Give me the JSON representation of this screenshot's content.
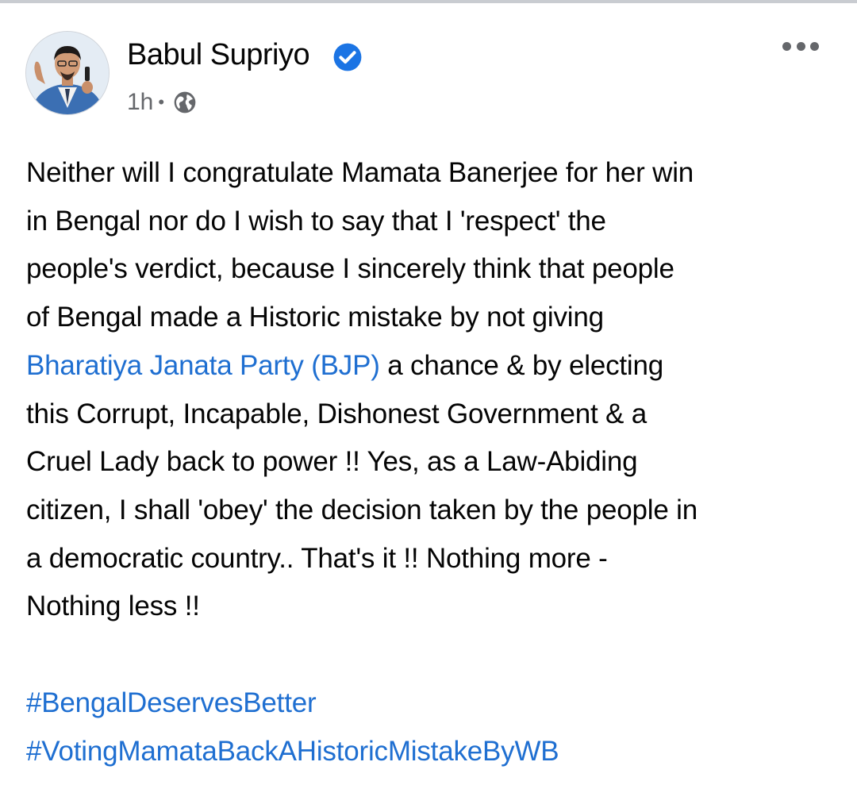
{
  "post": {
    "author": {
      "name": "Babul Supriyo",
      "verified_icon": "verified-badge-icon",
      "avatar_icon": "profile-photo"
    },
    "meta": {
      "time": "1h",
      "separator": "•",
      "audience_icon": "globe-icon"
    },
    "more_icon": "more-options-icon",
    "body": {
      "line1": "Neither will I congratulate Mamata Banerjee for her win",
      "line2": "in Bengal nor do I wish to say that I 'respect' the",
      "line3": "people's verdict, because I sincerely think that people",
      "line4": "of Bengal made a Historic mistake by not giving",
      "line5_mention": "Bharatiya Janata Party (BJP)",
      "line5_rest": " a chance & by electing",
      "line6": "this Corrupt, Incapable, Dishonest Government & a",
      "line7": "Cruel Lady back to power !! Yes, as a Law-Abiding",
      "line8": "citizen, I shall 'obey' the decision taken by the people in",
      "line9": "a democratic country.. That's it !! Nothing more -",
      "line10": "Nothing less !!"
    },
    "hashtags": [
      "#BengalDeservesBetter",
      "#VotingMamataBackAHistoricMistakeByWB"
    ]
  },
  "colors": {
    "link": "#1f6fd1",
    "verified": "#1b74e4",
    "secondary_text": "#65676b",
    "primary_text": "#050505"
  }
}
